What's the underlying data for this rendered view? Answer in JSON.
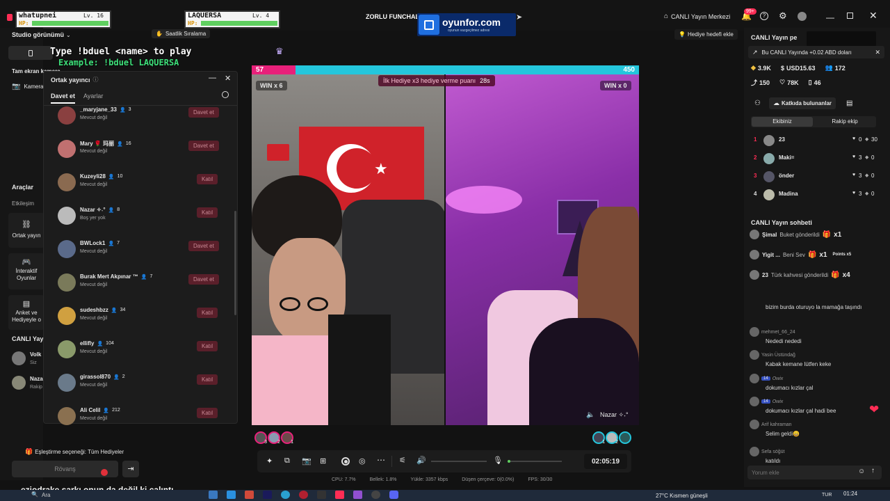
{
  "topbar": {
    "player1_name": "whatupnei",
    "player1_lv": "Lv. 16",
    "player1_hp": "HP:",
    "player2_name": "LAQUERSA",
    "player2_lv": "Lv. 4",
    "player2_hp": "HP:",
    "stream_title": "ZORLU FUNCHAL",
    "ad_brand": "oyunfor.com",
    "ad_tagline": "oyunun vazgeçilmez adresi",
    "live_center": "CANLI Yayın Merkezi",
    "notif_badge": "99+"
  },
  "left": {
    "studio_view": "Studio görünümü",
    "hourly_rank": "Saatlik Sıralama",
    "overlay_cmd": "Type !bduel <name> to play",
    "overlay_example": "Example: !bduel LAQUERSA",
    "fullscreen": "Tam ekran kamera",
    "camera": "Kamera",
    "tools": "Araçlar",
    "interaction": "Etkileşim",
    "co_stream": "Ortak yayın",
    "interactive_games": "İnteraktif Oyunlar",
    "poll": "Anket ve Hediyeyle o",
    "live_section": "CANLI Yayı",
    "live_u1": "Volk",
    "live_u1_sub": "Siz",
    "live_u2": "Naza",
    "live_u2_sub": "Rakip",
    "match_option": "Eşleştirme seçeneği: Tüm Hediyeler",
    "rematch": "Rövanş",
    "caption": "eziodrake şarkı onun da değil ki çalıntı"
  },
  "cohost": {
    "title": "Ortak yayıncı",
    "tab_invite": "Davet et",
    "tab_settings": "Ayarlar",
    "users": [
      {
        "name": "_maryjane_33",
        "count": "3",
        "status": "Mevcut değil",
        "action": "Davet et"
      },
      {
        "name": "Mary 🌹 玛丽",
        "count": "16",
        "status": "Mevcut değil",
        "action": "Davet et"
      },
      {
        "name": "Kuzeyli28",
        "count": "10",
        "status": "Mevcut değil",
        "action": "Katıl"
      },
      {
        "name": "Nazar ✧˖°",
        "count": "8",
        "status": "Boş yer yok",
        "action": "Katıl"
      },
      {
        "name": "BWLock1",
        "count": "7",
        "status": "Mevcut değil",
        "action": "Davet et"
      },
      {
        "name": "Burak Mert Akpınar ™",
        "count": "7",
        "status": "Mevcut değil",
        "action": "Davet et"
      },
      {
        "name": "sudeshbzz",
        "count": "34",
        "status": "Mevcut değil",
        "action": "Katıl"
      },
      {
        "name": "ellifly",
        "count": "104",
        "status": "Mevcut değil",
        "action": "Katıl"
      },
      {
        "name": "girassol870",
        "count": "2",
        "status": "Mevcut değil",
        "action": "Katıl"
      },
      {
        "name": "Ali Celil",
        "count": "212",
        "status": "Mevcut değil",
        "action": "Katıl"
      }
    ]
  },
  "battle": {
    "left_score": "57",
    "right_score": "450",
    "left_score_num": 57,
    "right_score_num": 450,
    "left_win": "WIN x 6",
    "right_win": "WIN x 0",
    "banner": "İlk Hediye x3 hediye verme puanı",
    "timer": "28s",
    "opponent_name": "Nazar ✧˖°",
    "left_badges": [
      "3",
      "2",
      "1"
    ],
    "right_badges": [
      "1",
      "2"
    ]
  },
  "controls": {
    "duration": "02:05:19"
  },
  "stats": {
    "cpu": "CPU:  7.7%",
    "memory": "Bellek:  1.8%",
    "upload": "Yükle:  3357 kbps",
    "dropped": "Düşen çerçeve:  0(0.0%)",
    "fps": "FPS:  30/30"
  },
  "right": {
    "gift_goal": "Hediye hedefi ekle",
    "live_pe": "CANLI Yayın pe",
    "earn_note": "Bu CANLI Yayında +0.02 ABD doları",
    "coins": "3.9K",
    "usd": "USD15.63",
    "viewers": "172",
    "shares": "150",
    "likes": "78K",
    "saves": "46",
    "contributors": "Katkıda bulunanlar",
    "tab_team": "Ekibiniz",
    "tab_rival": "Rakip ekip",
    "ranking": [
      {
        "rank": "1",
        "name": "23",
        "hearts": "0",
        "score": "30"
      },
      {
        "rank": "2",
        "name": "Maki=",
        "hearts": "3",
        "score": "0"
      },
      {
        "rank": "3",
        "name": "önder",
        "hearts": "3",
        "score": "0"
      },
      {
        "rank": "4",
        "name": "Madina",
        "hearts": "3",
        "score": "0"
      }
    ],
    "chat_title": "CANLI Yayın sohbeti",
    "gifts": [
      {
        "user": "Şimal",
        "text": "Buket gönderildi",
        "mult": "x1"
      },
      {
        "user": "Yigit ...",
        "text": "Beni Sev",
        "mult": "x1",
        "extra": "Points x5"
      },
      {
        "user": "23",
        "text": "Türk kahvesi gönderildi",
        "mult": "x4"
      }
    ],
    "chat": [
      {
        "user": "",
        "msg": "bizim burda oturuyo la mamağa taşındı"
      },
      {
        "user": "mehmet_66_24",
        "msg": "Nededi nededi"
      },
      {
        "user": "Yasin Üstündağ",
        "msg": "Kabak kemane lütfen keke"
      },
      {
        "user": "Owix",
        "level": "14",
        "msg": "dokumacı kızlar çal"
      },
      {
        "user": "Owix",
        "level": "14",
        "msg": "dokumacı kızlar çal hadi bee"
      },
      {
        "user": "Arif kahraman",
        "msg": "Selim geldi😄"
      },
      {
        "user": "Sefa söğüt",
        "msg": "katıldı"
      }
    ],
    "comment_placeholder": "Yorum ekle"
  },
  "taskbar": {
    "search": "Ara",
    "weather": "27°C  Kısmen güneşli",
    "lang": "TUR",
    "time": "01:24"
  },
  "colors": {
    "accent": "#ff2d55",
    "cyan": "#24c6dc",
    "pink": "#e8207a",
    "bg": "#121212"
  }
}
